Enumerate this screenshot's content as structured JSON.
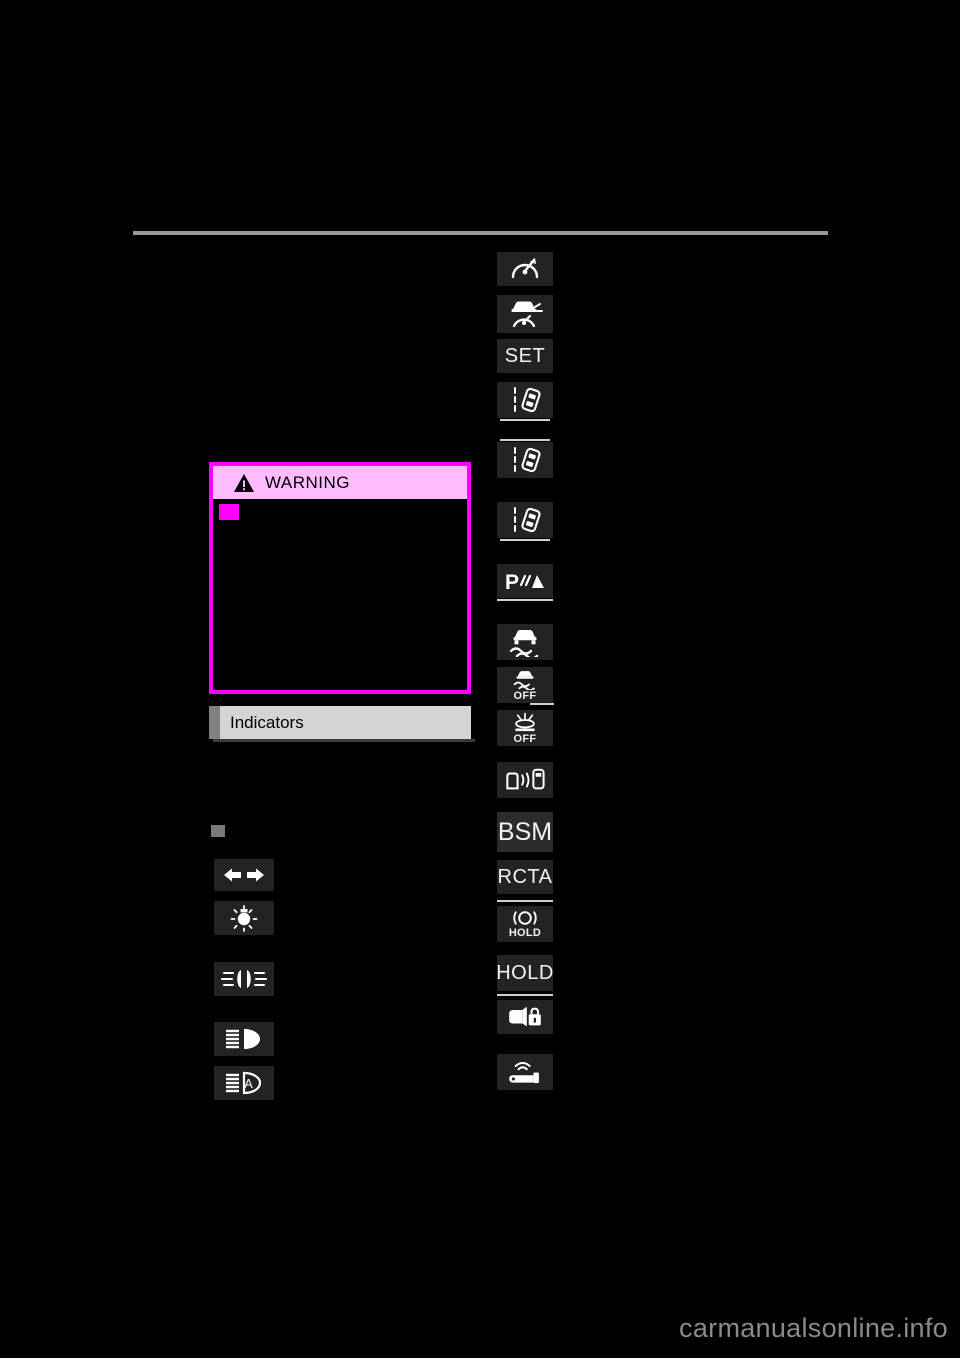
{
  "page": {
    "background": "#000000",
    "watermark": "carmanualsonline.info",
    "rule_color": "#9a9a9a"
  },
  "warning_box": {
    "title": "WARNING",
    "icon": "warning-triangle-icon",
    "header_bg": "#ffbbff",
    "border_color": "#ff00ff",
    "bullet_color": "#ff00ff"
  },
  "section": {
    "title": "Indicators",
    "header_bg": "#d4d4d4",
    "accent_color": "#808080",
    "bullet_color": "#7a7a7a"
  },
  "left_indicators": [
    {
      "name": "turn-signal-indicator",
      "icon": "turn-signal-arrows-icon",
      "label": ""
    },
    {
      "name": "tail-light-indicator",
      "icon": "tail-light-icon",
      "label": ""
    },
    {
      "name": "front-fog-light-indicator",
      "icon": "front-fog-light-icon",
      "label": ""
    },
    {
      "name": "high-beam-indicator",
      "icon": "high-beam-icon",
      "label": ""
    },
    {
      "name": "automatic-high-beam-indicator",
      "icon": "automatic-high-beam-icon",
      "label": "A"
    }
  ],
  "right_indicators": [
    {
      "name": "cruise-control-indicator",
      "icon": "cruise-control-icon",
      "label": ""
    },
    {
      "name": "dynamic-radar-cruise-control-indicator",
      "icon": "radar-cruise-control-icon",
      "label": ""
    },
    {
      "name": "cruise-set-indicator",
      "icon": "set-text-icon",
      "label": "SET"
    },
    {
      "name": "lane-departure-alert-indicator-1",
      "icon": "lane-departure-alert-icon",
      "label": ""
    },
    {
      "name": "lane-departure-alert-indicator-2",
      "icon": "lane-departure-alert-icon",
      "label": ""
    },
    {
      "name": "lane-departure-alert-indicator-3",
      "icon": "lane-departure-alert-icon",
      "label": ""
    },
    {
      "name": "parking-assist-indicator",
      "icon": "parking-sonar-icon",
      "label": "P"
    },
    {
      "name": "vsc-indicator",
      "icon": "skid-control-icon",
      "label": ""
    },
    {
      "name": "vsc-off-indicator",
      "icon": "skid-control-off-icon",
      "label": "OFF"
    },
    {
      "name": "traction-control-off-indicator",
      "icon": "traction-control-off-icon",
      "label": "OFF"
    },
    {
      "name": "blind-spot-monitor-indicator",
      "icon": "blind-spot-monitor-icon",
      "label": ""
    },
    {
      "name": "bsm-text-indicator",
      "icon": "bsm-text-icon",
      "label": "BSM"
    },
    {
      "name": "rcta-text-indicator",
      "icon": "rcta-text-icon",
      "label": "RCTA"
    },
    {
      "name": "brake-hold-indicator",
      "icon": "brake-hold-icon",
      "label": "HOLD"
    },
    {
      "name": "hold-text-indicator",
      "icon": "hold-text-icon",
      "label": "HOLD"
    },
    {
      "name": "steering-lock-indicator",
      "icon": "steering-lock-icon",
      "label": ""
    },
    {
      "name": "smart-key-indicator",
      "icon": "smart-key-icon",
      "label": ""
    }
  ]
}
